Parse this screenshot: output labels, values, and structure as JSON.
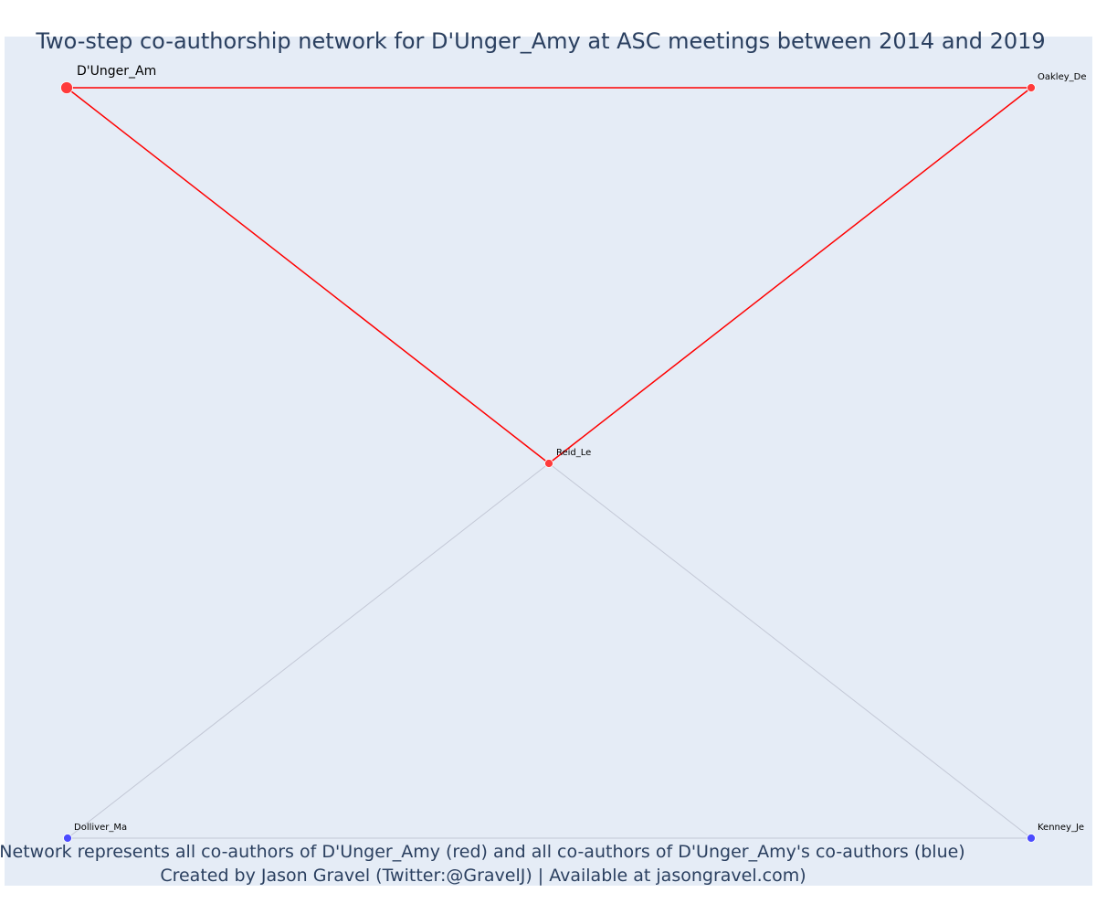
{
  "title": "Two-step co-authorship network for D'Unger_Amy at ASC meetings between 2014 and 2019",
  "caption": {
    "line1": "Network represents all co-authors of D'Unger_Amy (red) and all co-authors of D'Unger_Amy's co-authors (blue)",
    "line2": "Created by Jason Gravel (Twitter:@GravelJ) | Available at jasongravel.com)"
  },
  "colors": {
    "plot_background": "#e5ecf6",
    "title_text": "#2a3f5f",
    "direct_coauthor": "#ff3b3b",
    "second_step_coauthor": "#4b4bff",
    "direct_edge": "#ff0000",
    "second_step_edge": "#c3c8d6"
  },
  "chart_data": {
    "type": "network",
    "nodes": [
      {
        "id": "dunger",
        "label": "D'Unger_Am",
        "group": "focal"
      },
      {
        "id": "oakley",
        "label": "Oakley_De",
        "group": "co-author"
      },
      {
        "id": "reid",
        "label": "Reid_Le",
        "group": "co-author"
      },
      {
        "id": "dolliver",
        "label": "Dolliver_Ma",
        "group": "co-author-of-co-author"
      },
      {
        "id": "kenney",
        "label": "Kenney_Je",
        "group": "co-author-of-co-author"
      }
    ],
    "edges": [
      {
        "source": "dunger",
        "target": "oakley",
        "type": "direct"
      },
      {
        "source": "dunger",
        "target": "reid",
        "type": "direct"
      },
      {
        "source": "oakley",
        "target": "reid",
        "type": "direct"
      },
      {
        "source": "reid",
        "target": "dolliver",
        "type": "second-step"
      },
      {
        "source": "reid",
        "target": "kenney",
        "type": "second-step"
      },
      {
        "source": "dolliver",
        "target": "kenney",
        "type": "second-step"
      }
    ]
  }
}
